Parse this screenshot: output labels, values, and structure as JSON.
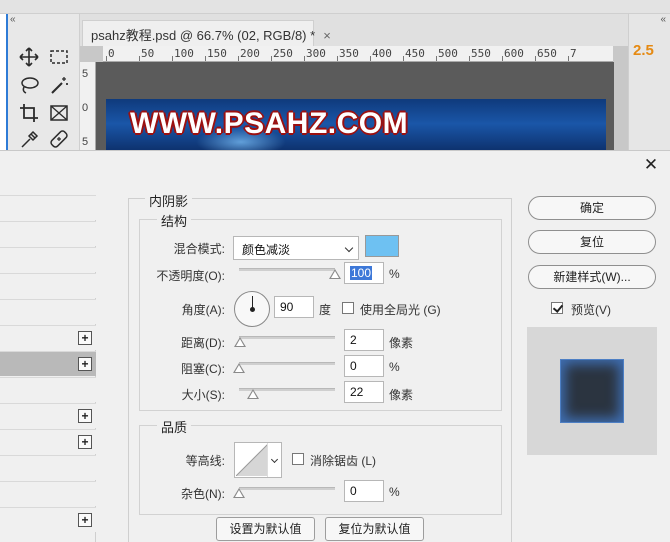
{
  "document_tab": {
    "title": "psahz教程.psd @ 66.7% (02, RGB/8) *",
    "close_glyph": "×"
  },
  "ruler_h": {
    "labels": [
      "0",
      "50",
      "100",
      "150",
      "200",
      "250",
      "300",
      "350",
      "400",
      "450",
      "500",
      "550",
      "600",
      "650",
      "7"
    ]
  },
  "ruler_v": {
    "labels": [
      "5",
      "0",
      "5"
    ]
  },
  "canvas": {
    "text": "WWW.PSAHZ.COM"
  },
  "right_panel": {
    "zoom_value": "2.5"
  },
  "collapse_glyph": "«",
  "dialog": {
    "close_glyph": "✕",
    "section_title": "内阴影",
    "structure": {
      "title": "结构",
      "blend_mode_label": "混合模式:",
      "blend_mode_value": "颜色减淡",
      "blend_color": "#6ec1f2",
      "opacity_label": "不透明度(O):",
      "opacity_value": "100",
      "opacity_percent": 100,
      "percent_unit": "%",
      "angle_label": "角度(A):",
      "angle_value": "90",
      "angle_unit": "度",
      "global_light_label": "使用全局光 (G)",
      "global_light_checked": false,
      "distance_label": "距离(D):",
      "distance_value": "2",
      "choke_label": "阻塞(C):",
      "choke_value": "0",
      "size_label": "大小(S):",
      "size_value": "22",
      "pixel_unit": "像素"
    },
    "quality": {
      "title": "品质",
      "contour_label": "等高线:",
      "anti_alias_label": "消除锯齿 (L)",
      "anti_alias_checked": false,
      "noise_label": "杂色(N):",
      "noise_value": "0"
    },
    "buttons": {
      "make_default": "设置为默认值",
      "reset_default": "复位为默认值",
      "ok": "确定",
      "reset": "复位",
      "new_style": "新建样式(W)...",
      "preview_label": "预览(V)",
      "preview_checked": true
    },
    "style_list_rows": [
      {
        "has_plus": false,
        "selected": false
      },
      {
        "has_plus": false,
        "selected": false
      },
      {
        "has_plus": false,
        "selected": false
      },
      {
        "has_plus": false,
        "selected": false
      },
      {
        "has_plus": false,
        "selected": false
      },
      {
        "has_plus": true,
        "selected": false
      },
      {
        "has_plus": true,
        "selected": true
      },
      {
        "has_plus": false,
        "selected": false
      },
      {
        "has_plus": true,
        "selected": false
      },
      {
        "has_plus": true,
        "selected": false
      },
      {
        "has_plus": false,
        "selected": false
      },
      {
        "has_plus": false,
        "selected": false
      },
      {
        "has_plus": true,
        "selected": false
      }
    ]
  }
}
